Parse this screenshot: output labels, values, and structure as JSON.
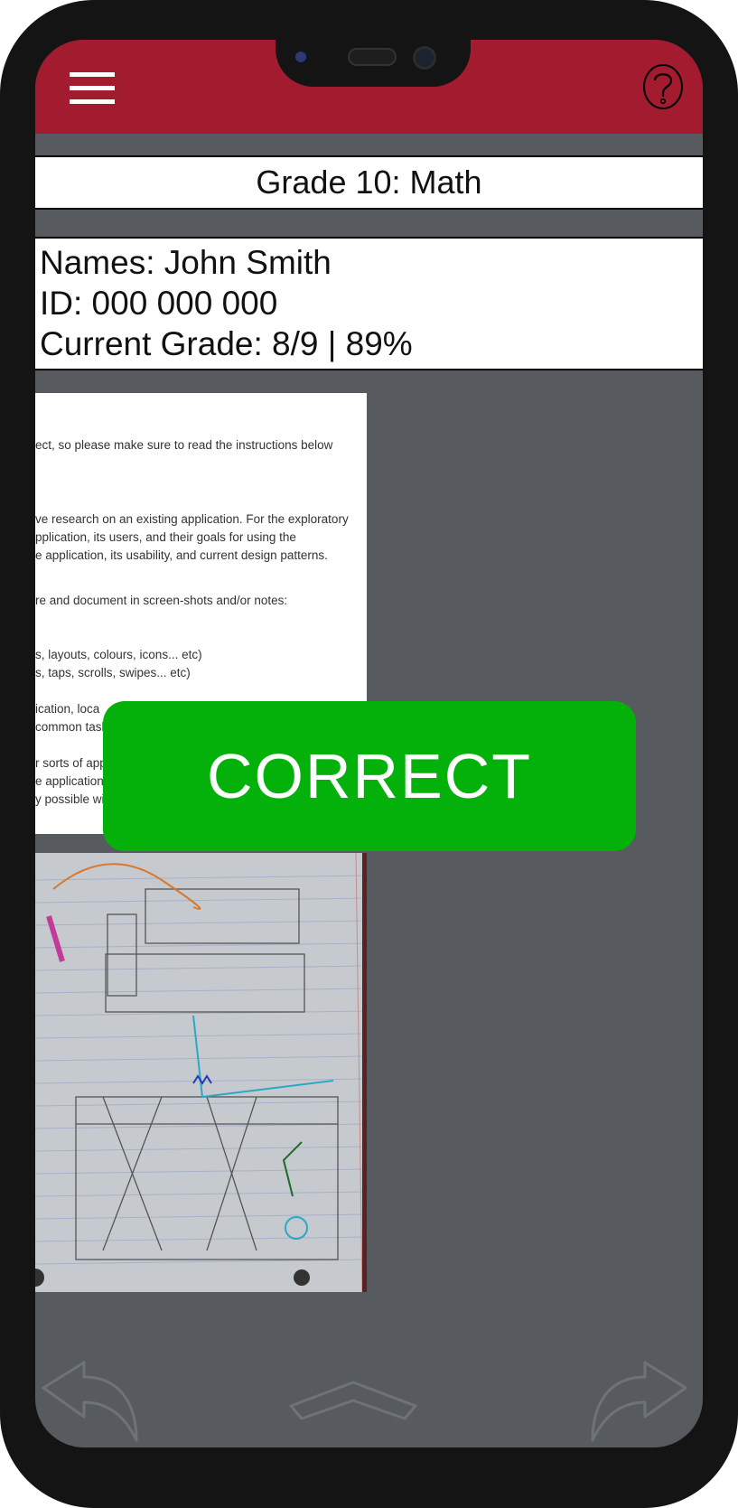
{
  "header": {
    "menu_icon": "hamburger-menu-icon",
    "help_icon": "question-mark-circle-icon",
    "accent_color": "#a31b2f"
  },
  "course": {
    "title": "Grade 10: Math"
  },
  "student": {
    "name_line": "Names: John Smith",
    "id_line": "ID: 000 000 000",
    "grade_line": "Current Grade: 8/9 | 89%"
  },
  "document_lines": [
    "ect, so please make sure to read the instructions below",
    "ve research on an existing application. For the exploratory",
    "pplication, its users, and their goals for using the",
    "e application, its usability, and current design patterns.",
    "re and document in screen-shots and/or notes:",
    "s, layouts, colours, icons... etc)",
    "s, taps, scrolls, swipes... etc)",
    "ication, loca",
    "common task",
    "r sorts of app",
    "e application",
    "y possible wi"
  ],
  "feedback": {
    "label": "CORRECT",
    "color": "#04b10a"
  },
  "navigation": {
    "back_icon": "back-arrow-icon",
    "home_icon": "chevron-up-icon",
    "forward_icon": "forward-arrow-icon"
  }
}
